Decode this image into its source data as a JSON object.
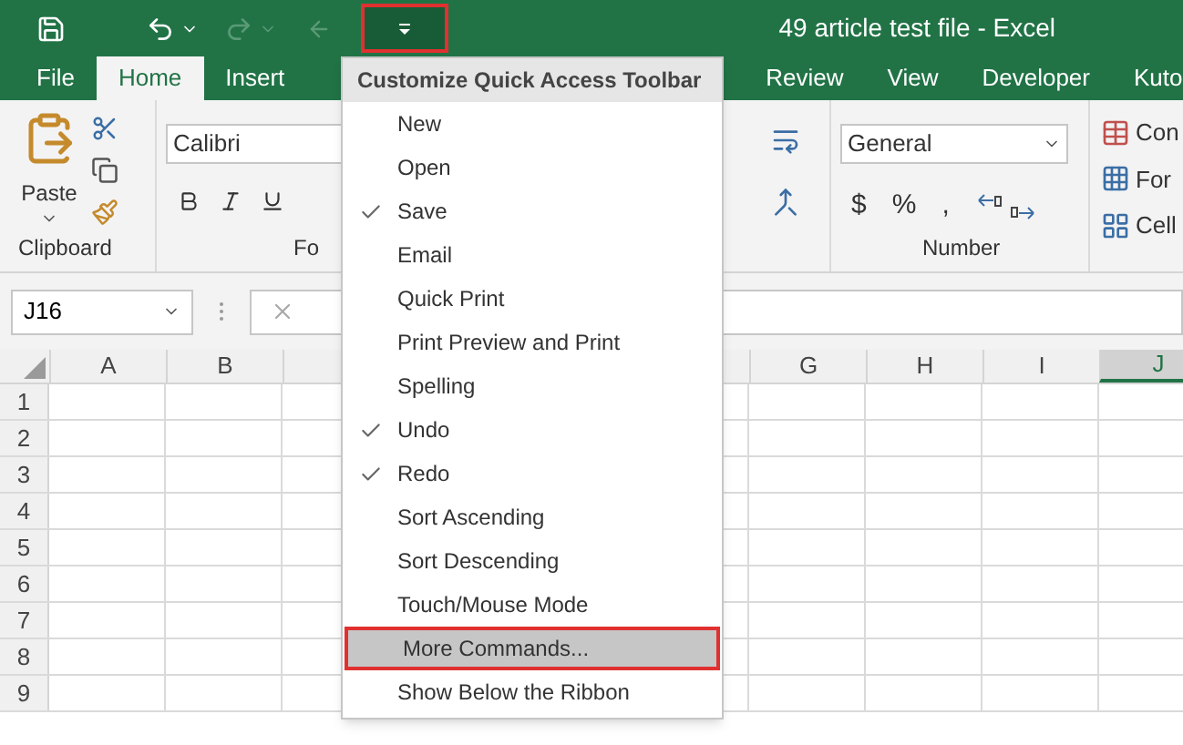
{
  "title_bar": {
    "title": "49 article test file - Excel",
    "qat_dropdown": {
      "selected": true
    }
  },
  "tabs": [
    {
      "label": "File",
      "selected": false
    },
    {
      "label": "Home",
      "selected": true
    },
    {
      "label": "Insert",
      "selected": false
    },
    {
      "label": "Review",
      "selected": false
    },
    {
      "label": "View",
      "selected": false
    },
    {
      "label": "Developer",
      "selected": false
    },
    {
      "label": "Kuto",
      "selected": false
    }
  ],
  "ribbon": {
    "clipboard": {
      "paste_label": "Paste",
      "group_label": "Clipboard"
    },
    "font": {
      "font_name": "Calibri",
      "group_label": "Fo"
    },
    "number": {
      "format": "General",
      "group_label": "Number",
      "symbols": [
        "$",
        "%",
        ","
      ]
    },
    "styles": {
      "items": [
        "Con",
        "For",
        "Cell"
      ]
    }
  },
  "formula_bar": {
    "name_box": "J16"
  },
  "sheet": {
    "columns_left": [
      {
        "label": "A",
        "selected": false
      },
      {
        "label": "B",
        "selected": false
      }
    ],
    "columns_right": [
      {
        "label": "G",
        "selected": false
      },
      {
        "label": "H",
        "selected": false
      },
      {
        "label": "I",
        "selected": false
      },
      {
        "label": "J",
        "selected": true
      }
    ],
    "rows": [
      "1",
      "2",
      "3",
      "4",
      "5",
      "6",
      "7",
      "8",
      "9"
    ]
  },
  "menu": {
    "title": "Customize Quick Access Toolbar",
    "items": [
      {
        "label": "New",
        "checked": false,
        "highlighted": false
      },
      {
        "label": "Open",
        "checked": false,
        "highlighted": false
      },
      {
        "label": "Save",
        "checked": true,
        "highlighted": false
      },
      {
        "label": "Email",
        "checked": false,
        "highlighted": false
      },
      {
        "label": "Quick Print",
        "checked": false,
        "highlighted": false
      },
      {
        "label": "Print Preview and Print",
        "checked": false,
        "highlighted": false
      },
      {
        "label": "Spelling",
        "checked": false,
        "highlighted": false
      },
      {
        "label": "Undo",
        "checked": true,
        "highlighted": false
      },
      {
        "label": "Redo",
        "checked": true,
        "highlighted": false
      },
      {
        "label": "Sort Ascending",
        "checked": false,
        "highlighted": false
      },
      {
        "label": "Sort Descending",
        "checked": false,
        "highlighted": false
      },
      {
        "label": "Touch/Mouse Mode",
        "checked": false,
        "highlighted": false
      },
      {
        "label": "More Commands...",
        "checked": false,
        "highlighted": true
      },
      {
        "label": "Show Below the Ribbon",
        "checked": false,
        "highlighted": false
      }
    ]
  }
}
